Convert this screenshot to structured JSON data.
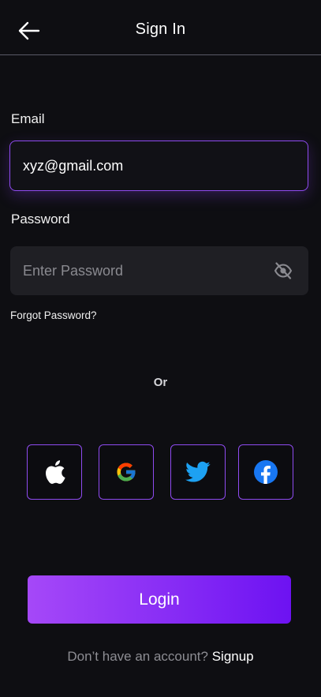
{
  "header": {
    "title": "Sign In",
    "back_icon": "arrow-left-icon"
  },
  "form": {
    "email_label": "Email",
    "email_value": "xyz@gmail.com",
    "password_label": "Password",
    "password_placeholder": "Enter Password",
    "password_toggle_icon": "eye-off-icon",
    "forgot_label": "Forgot Password?"
  },
  "divider": {
    "text": "Or"
  },
  "social": [
    {
      "name": "apple",
      "icon": "apple-icon",
      "color": "#ffffff"
    },
    {
      "name": "google",
      "icon": "google-icon",
      "colors": [
        "#4285F4",
        "#EA4335",
        "#FBBC05",
        "#34A853"
      ]
    },
    {
      "name": "twitter",
      "icon": "twitter-icon",
      "color": "#1DA1F2"
    },
    {
      "name": "facebook",
      "icon": "facebook-icon",
      "color": "#1877F2"
    }
  ],
  "login": {
    "label": "Login"
  },
  "signup": {
    "prompt": "Don’t have an account?",
    "link": "Signup"
  },
  "colors": {
    "background": "#0e0e12",
    "accent": "#8f4bf0",
    "button_gradient_start": "#a548f8",
    "button_gradient_end": "#6d12f2"
  }
}
